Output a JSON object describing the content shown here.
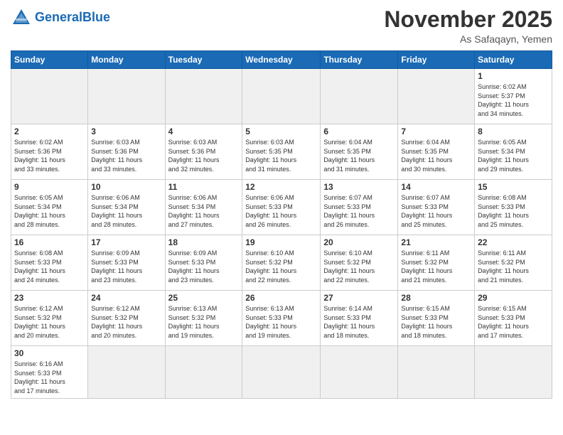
{
  "header": {
    "logo_general": "General",
    "logo_blue": "Blue",
    "month": "November 2025",
    "location": "As Safaqayn, Yemen"
  },
  "weekdays": [
    "Sunday",
    "Monday",
    "Tuesday",
    "Wednesday",
    "Thursday",
    "Friday",
    "Saturday"
  ],
  "days": [
    {
      "num": "",
      "info": ""
    },
    {
      "num": "",
      "info": ""
    },
    {
      "num": "",
      "info": ""
    },
    {
      "num": "",
      "info": ""
    },
    {
      "num": "",
      "info": ""
    },
    {
      "num": "",
      "info": ""
    },
    {
      "num": "1",
      "info": "Sunrise: 6:02 AM\nSunset: 5:37 PM\nDaylight: 11 hours\nand 34 minutes."
    },
    {
      "num": "2",
      "info": "Sunrise: 6:02 AM\nSunset: 5:36 PM\nDaylight: 11 hours\nand 33 minutes."
    },
    {
      "num": "3",
      "info": "Sunrise: 6:03 AM\nSunset: 5:36 PM\nDaylight: 11 hours\nand 33 minutes."
    },
    {
      "num": "4",
      "info": "Sunrise: 6:03 AM\nSunset: 5:36 PM\nDaylight: 11 hours\nand 32 minutes."
    },
    {
      "num": "5",
      "info": "Sunrise: 6:03 AM\nSunset: 5:35 PM\nDaylight: 11 hours\nand 31 minutes."
    },
    {
      "num": "6",
      "info": "Sunrise: 6:04 AM\nSunset: 5:35 PM\nDaylight: 11 hours\nand 31 minutes."
    },
    {
      "num": "7",
      "info": "Sunrise: 6:04 AM\nSunset: 5:35 PM\nDaylight: 11 hours\nand 30 minutes."
    },
    {
      "num": "8",
      "info": "Sunrise: 6:05 AM\nSunset: 5:34 PM\nDaylight: 11 hours\nand 29 minutes."
    },
    {
      "num": "9",
      "info": "Sunrise: 6:05 AM\nSunset: 5:34 PM\nDaylight: 11 hours\nand 28 minutes."
    },
    {
      "num": "10",
      "info": "Sunrise: 6:06 AM\nSunset: 5:34 PM\nDaylight: 11 hours\nand 28 minutes."
    },
    {
      "num": "11",
      "info": "Sunrise: 6:06 AM\nSunset: 5:34 PM\nDaylight: 11 hours\nand 27 minutes."
    },
    {
      "num": "12",
      "info": "Sunrise: 6:06 AM\nSunset: 5:33 PM\nDaylight: 11 hours\nand 26 minutes."
    },
    {
      "num": "13",
      "info": "Sunrise: 6:07 AM\nSunset: 5:33 PM\nDaylight: 11 hours\nand 26 minutes."
    },
    {
      "num": "14",
      "info": "Sunrise: 6:07 AM\nSunset: 5:33 PM\nDaylight: 11 hours\nand 25 minutes."
    },
    {
      "num": "15",
      "info": "Sunrise: 6:08 AM\nSunset: 5:33 PM\nDaylight: 11 hours\nand 25 minutes."
    },
    {
      "num": "16",
      "info": "Sunrise: 6:08 AM\nSunset: 5:33 PM\nDaylight: 11 hours\nand 24 minutes."
    },
    {
      "num": "17",
      "info": "Sunrise: 6:09 AM\nSunset: 5:33 PM\nDaylight: 11 hours\nand 23 minutes."
    },
    {
      "num": "18",
      "info": "Sunrise: 6:09 AM\nSunset: 5:33 PM\nDaylight: 11 hours\nand 23 minutes."
    },
    {
      "num": "19",
      "info": "Sunrise: 6:10 AM\nSunset: 5:32 PM\nDaylight: 11 hours\nand 22 minutes."
    },
    {
      "num": "20",
      "info": "Sunrise: 6:10 AM\nSunset: 5:32 PM\nDaylight: 11 hours\nand 22 minutes."
    },
    {
      "num": "21",
      "info": "Sunrise: 6:11 AM\nSunset: 5:32 PM\nDaylight: 11 hours\nand 21 minutes."
    },
    {
      "num": "22",
      "info": "Sunrise: 6:11 AM\nSunset: 5:32 PM\nDaylight: 11 hours\nand 21 minutes."
    },
    {
      "num": "23",
      "info": "Sunrise: 6:12 AM\nSunset: 5:32 PM\nDaylight: 11 hours\nand 20 minutes."
    },
    {
      "num": "24",
      "info": "Sunrise: 6:12 AM\nSunset: 5:32 PM\nDaylight: 11 hours\nand 20 minutes."
    },
    {
      "num": "25",
      "info": "Sunrise: 6:13 AM\nSunset: 5:32 PM\nDaylight: 11 hours\nand 19 minutes."
    },
    {
      "num": "26",
      "info": "Sunrise: 6:13 AM\nSunset: 5:33 PM\nDaylight: 11 hours\nand 19 minutes."
    },
    {
      "num": "27",
      "info": "Sunrise: 6:14 AM\nSunset: 5:33 PM\nDaylight: 11 hours\nand 18 minutes."
    },
    {
      "num": "28",
      "info": "Sunrise: 6:15 AM\nSunset: 5:33 PM\nDaylight: 11 hours\nand 18 minutes."
    },
    {
      "num": "29",
      "info": "Sunrise: 6:15 AM\nSunset: 5:33 PM\nDaylight: 11 hours\nand 17 minutes."
    },
    {
      "num": "30",
      "info": "Sunrise: 6:16 AM\nSunset: 5:33 PM\nDaylight: 11 hours\nand 17 minutes."
    },
    {
      "num": "",
      "info": ""
    },
    {
      "num": "",
      "info": ""
    },
    {
      "num": "",
      "info": ""
    },
    {
      "num": "",
      "info": ""
    },
    {
      "num": "",
      "info": ""
    },
    {
      "num": "",
      "info": ""
    }
  ]
}
